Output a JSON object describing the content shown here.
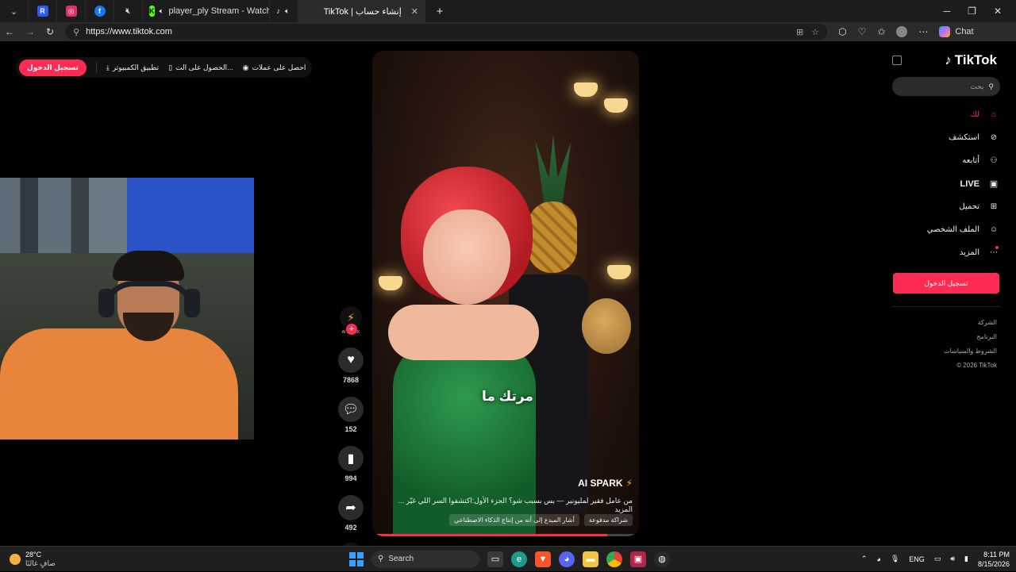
{
  "browser": {
    "tabs": [
      {
        "title": "",
        "icon": "chevron-down-icon"
      },
      {
        "title": "",
        "icon": "r-app-icon",
        "color": "#2b5cf5"
      },
      {
        "title": "",
        "icon": "instagram-icon",
        "color": "#e1306c"
      },
      {
        "title": "",
        "icon": "facebook-icon",
        "color": "#1877f2"
      },
      {
        "title": "",
        "icon": "mute-icon"
      },
      {
        "title": "player_ply Stream - Watch Liv",
        "icon": "kick-icon",
        "color": "#53fc18"
      },
      {
        "title": "",
        "icon": "tiktok-icon"
      },
      {
        "title": "TikTok | إنشاء حساب",
        "icon": "tiktok-icon",
        "active": true
      }
    ],
    "url": "https://www.tiktok.com",
    "chat_label": "Chat"
  },
  "topbar": {
    "signin": "تسجيل الدخول",
    "desktop_app": "تطبيق الكمبيوتر",
    "get_app": "الحصول على الت...",
    "coins": "احصل على عملات"
  },
  "video": {
    "subtitle": "مرتك ما",
    "creator": "AI SPARK",
    "description": "من عامل فقير لمليونير — بس بسبب شو؟ الجزء الأول:اكتشفوا السر اللي غيّر ... المزيد",
    "tag_paid": "شراكة مدفوعة",
    "tag_ai": "أشار المبدع إلى أنه من إنتاج الذكاء الاصطناعي",
    "progress": 0.88
  },
  "rail": {
    "avatar_label": "AI SPARK",
    "likes": "7868",
    "comments": "152",
    "saves": "994",
    "shares": "492"
  },
  "sidebar": {
    "logo": "TikTok",
    "search_placeholder": "بحث",
    "items": [
      {
        "label": "لك",
        "icon": "home-icon",
        "active": true
      },
      {
        "label": "استكشف",
        "icon": "compass-icon"
      },
      {
        "label": "أتابعه",
        "icon": "following-icon"
      },
      {
        "label": "LIVE",
        "icon": "live-icon"
      },
      {
        "label": "تحميل",
        "icon": "upload-icon"
      },
      {
        "label": "الملف الشخصي",
        "icon": "profile-icon"
      },
      {
        "label": "المزيد",
        "icon": "more-icon"
      }
    ],
    "signin": "تسجيل الدخول",
    "footer": [
      "الشركة",
      "البرنامج",
      "الشروط والسياسات",
      "© 2026 TikTok"
    ]
  },
  "taskbar": {
    "temp": "28°C",
    "weather": "صافٍ غالبًا",
    "search": "Search",
    "lang": "ENG",
    "time": "8:11 PM",
    "date": "8/15/2026"
  },
  "colors": {
    "accent": "#fe2c55"
  }
}
